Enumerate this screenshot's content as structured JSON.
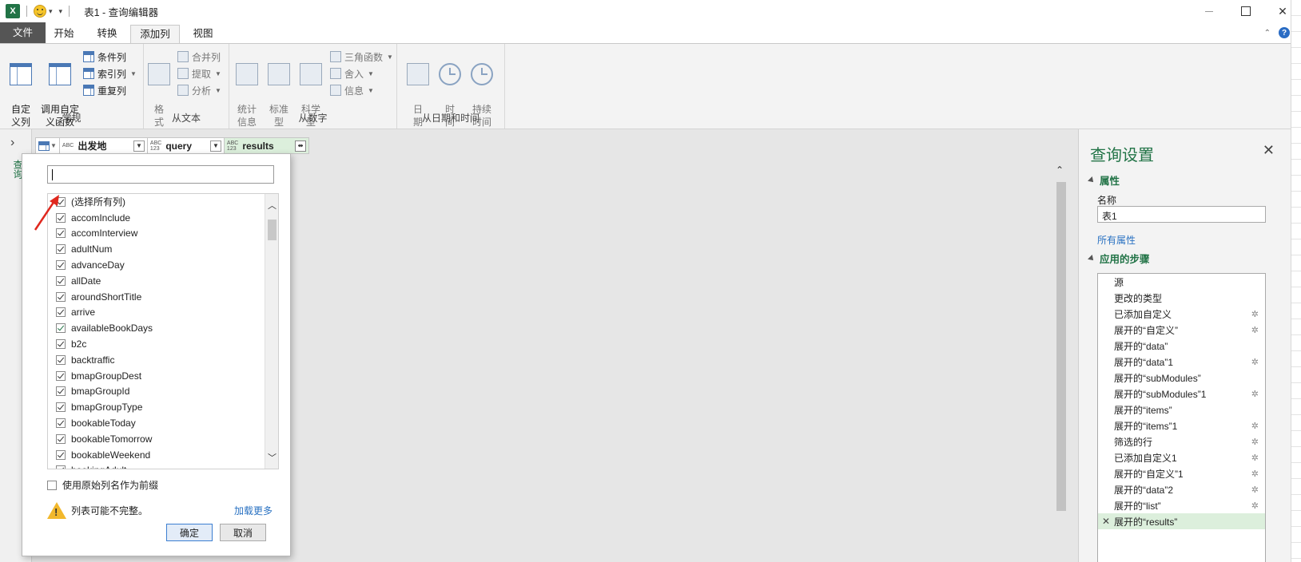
{
  "window": {
    "app_logo": "X",
    "title": "表1 - 查询编辑器"
  },
  "tabs": [
    {
      "label": "文件"
    },
    {
      "label": "开始"
    },
    {
      "label": "转换"
    },
    {
      "label": "添加列"
    },
    {
      "label": "视图"
    }
  ],
  "ribbon": {
    "general": {
      "label": "常规",
      "custom_col": "自定\n义列",
      "invoke_fn": "调用自定\n义函数",
      "cond_col": "条件列",
      "index_col": "索引列",
      "dup_col": "重复列"
    },
    "text": {
      "label": "从文本",
      "format": "格\n式",
      "merge": "合并列",
      "extract": "提取",
      "parse": "分析"
    },
    "number": {
      "label": "从数字",
      "stats": "统计\n信息",
      "standard": "标准\n型",
      "sci": "科学\n型",
      "trig": "三角函数",
      "round": "舍入",
      "info": "信息"
    },
    "datetime": {
      "label": "从日期和时间",
      "date": "日\n期",
      "time": "时\n间",
      "duration": "持续\n时间"
    }
  },
  "nav": {
    "vertical_label": "查询"
  },
  "columns": [
    {
      "type": "ABC",
      "name": "出发地"
    },
    {
      "type": "ABC\n123",
      "name": "query"
    },
    {
      "type": "ABC\n123",
      "name": "results"
    }
  ],
  "popup": {
    "search_value": "",
    "items": [
      {
        "label": "(选择所有列)",
        "checked": true
      },
      {
        "label": "accomInclude",
        "checked": true
      },
      {
        "label": "accomInterview",
        "checked": true
      },
      {
        "label": "adultNum",
        "checked": true
      },
      {
        "label": "advanceDay",
        "checked": true
      },
      {
        "label": "allDate",
        "checked": true
      },
      {
        "label": "aroundShortTitle",
        "checked": true
      },
      {
        "label": "arrive",
        "checked": true
      },
      {
        "label": "availableBookDays",
        "checked": true
      },
      {
        "label": "b2c",
        "checked": true
      },
      {
        "label": "backtraffic",
        "checked": true
      },
      {
        "label": "bmapGroupDest",
        "checked": true
      },
      {
        "label": "bmapGroupId",
        "checked": true
      },
      {
        "label": "bmapGroupType",
        "checked": true
      },
      {
        "label": "bookableToday",
        "checked": true
      },
      {
        "label": "bookableTomorrow",
        "checked": true
      },
      {
        "label": "bookableWeekend",
        "checked": true
      },
      {
        "label": "bookingAdult",
        "checked": true
      }
    ],
    "prefix_label": "使用原始列名作为前缀",
    "prefix_checked": false,
    "warning": "列表可能不完整。",
    "load_more": "加载更多",
    "ok": "确定",
    "cancel": "取消"
  },
  "query_settings": {
    "title": "查询设置",
    "properties": "属性",
    "name_label": "名称",
    "name_value": "表1",
    "all_props": "所有属性",
    "applied_steps": "应用的步骤",
    "steps": [
      {
        "label": "源",
        "gear": false
      },
      {
        "label": "更改的类型",
        "gear": false
      },
      {
        "label": "已添加自定义",
        "gear": true
      },
      {
        "label": "展开的“自定义”",
        "gear": true
      },
      {
        "label": "展开的“data”",
        "gear": false
      },
      {
        "label": "展开的“data”1",
        "gear": true
      },
      {
        "label": "展开的“subModules”",
        "gear": false
      },
      {
        "label": "展开的“subModules”1",
        "gear": true
      },
      {
        "label": "展开的“items”",
        "gear": false
      },
      {
        "label": "展开的“items”1",
        "gear": true
      },
      {
        "label": "筛选的行",
        "gear": true
      },
      {
        "label": "已添加自定义1",
        "gear": true
      },
      {
        "label": "展开的“自定义”1",
        "gear": true
      },
      {
        "label": "展开的“data”2",
        "gear": true
      },
      {
        "label": "展开的“list”",
        "gear": true
      },
      {
        "label": "展开的“results”",
        "gear": false,
        "selected": true
      }
    ]
  },
  "colors": {
    "excel_green": "#217346",
    "selected_step": "#dcefdc",
    "link_blue": "#2a72c2"
  }
}
